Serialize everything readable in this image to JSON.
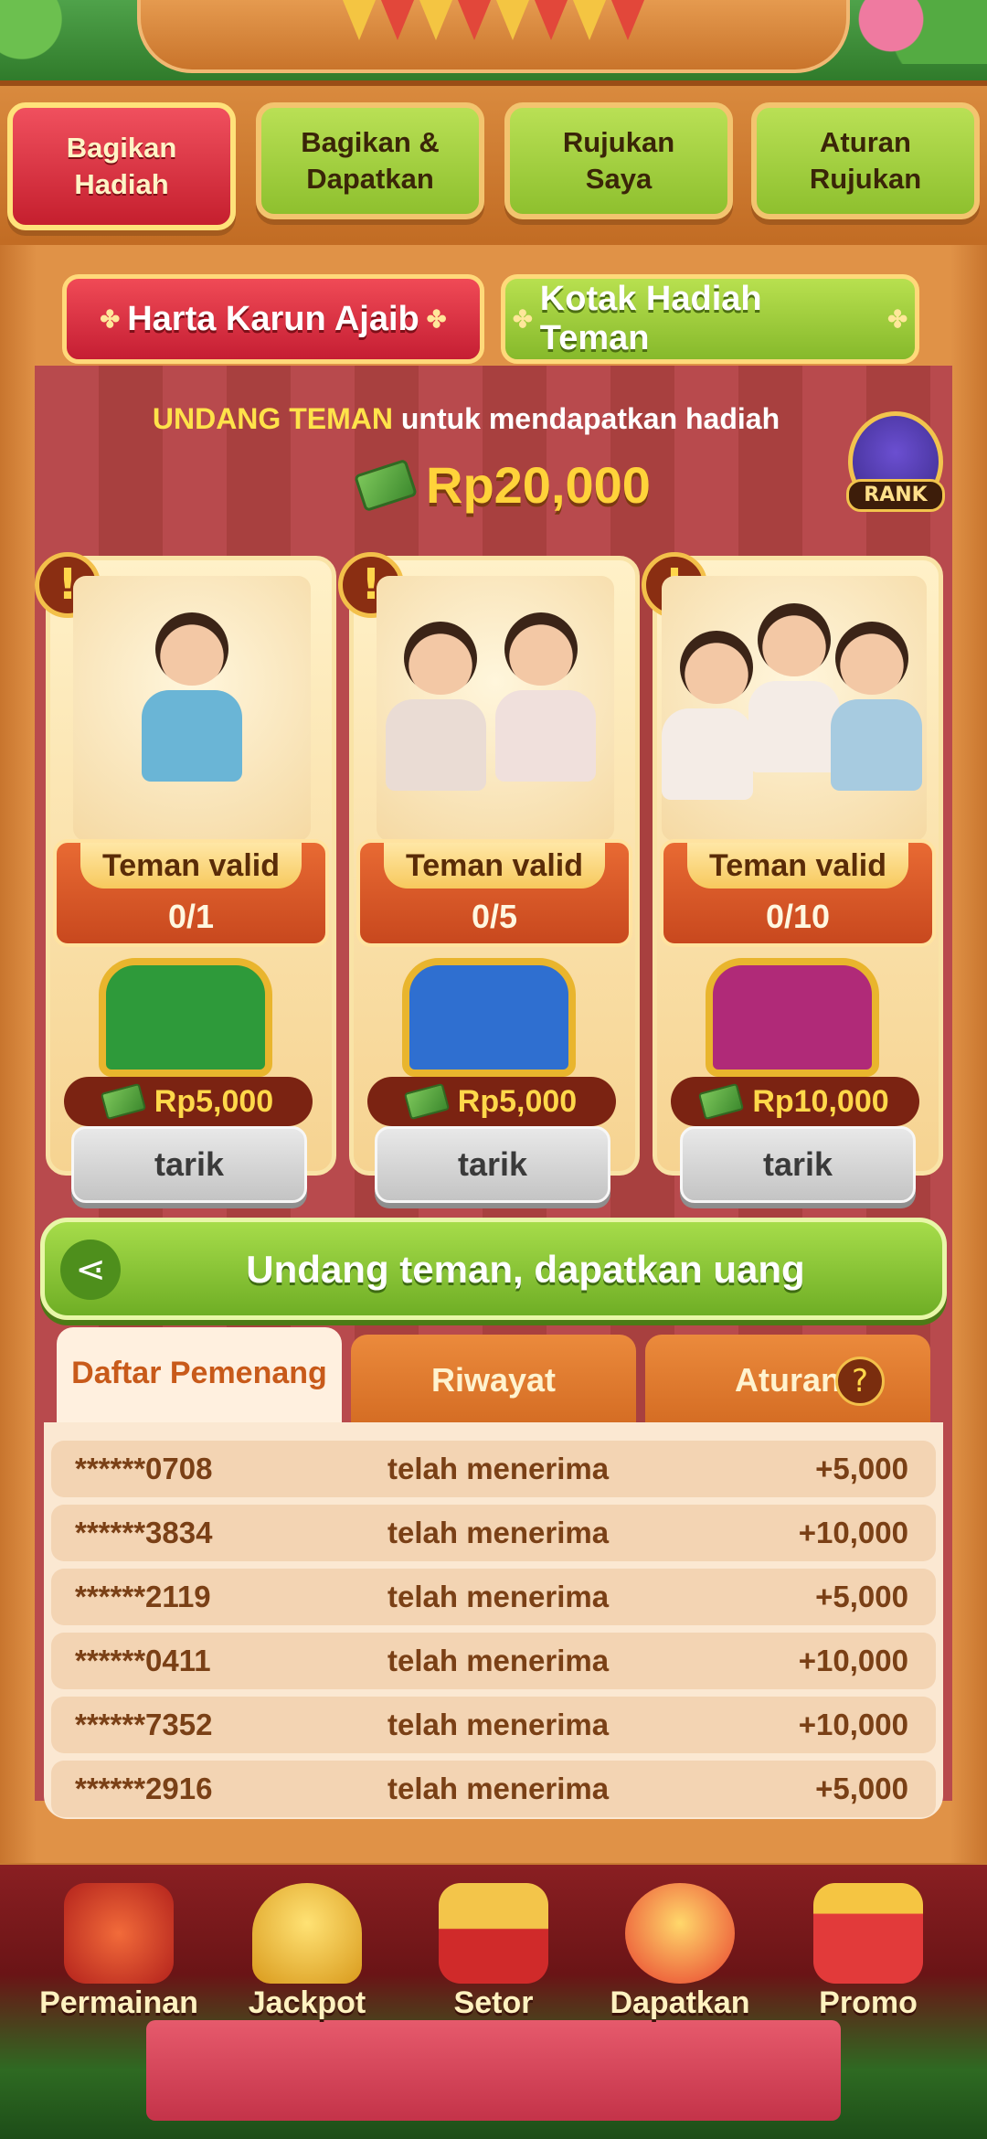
{
  "tabs": [
    {
      "label": "Bagikan\nHadiah",
      "active": true
    },
    {
      "label": "Bagikan &\nDapatkan",
      "active": false
    },
    {
      "label": "Rujukan\nSaya",
      "active": false
    },
    {
      "label": "Aturan\nRujukan",
      "active": false
    }
  ],
  "sub_buttons": {
    "treasure": "Harta Karun Ajaib",
    "friend_box": "Kotak Hadiah Teman"
  },
  "invite": {
    "highlight": "UNDANG TEMAN",
    "rest": " untuk mendapatkan hadiah",
    "amount": "Rp20,000",
    "rank_label": "RANK"
  },
  "cards": [
    {
      "valid_label": "Teman valid",
      "count": "0/1",
      "reward": "Rp5,000",
      "button": "tarik",
      "chest_color": "#2e9a3a"
    },
    {
      "valid_label": "Teman valid",
      "count": "0/5",
      "reward": "Rp5,000",
      "button": "tarik",
      "chest_color": "#2f6fd0"
    },
    {
      "valid_label": "Teman valid",
      "count": "0/10",
      "reward": "Rp10,000",
      "button": "tarik",
      "chest_color": "#b02a78"
    }
  ],
  "invite_button": "Undang teman, dapatkan uang",
  "list_tabs": {
    "winners": "Daftar Pemenang",
    "history": "Riwayat",
    "rules": "Aturan",
    "help": "?"
  },
  "winners": [
    {
      "user": "******0708",
      "status": "telah menerima",
      "amount": "+5,000"
    },
    {
      "user": "******3834",
      "status": "telah menerima",
      "amount": "+10,000"
    },
    {
      "user": "******2119",
      "status": "telah menerima",
      "amount": "+5,000"
    },
    {
      "user": "******0411",
      "status": "telah menerima",
      "amount": "+10,000"
    },
    {
      "user": "******7352",
      "status": "telah menerima",
      "amount": "+10,000"
    },
    {
      "user": "******2916",
      "status": "telah menerima",
      "amount": "+5,000"
    }
  ],
  "bottom_nav": [
    {
      "label": "Permainan",
      "icon": "slot-machine-icon"
    },
    {
      "label": "Jackpot",
      "icon": "trophy-icon"
    },
    {
      "label": "Setor",
      "icon": "coin-chest-icon"
    },
    {
      "label": "Dapatkan",
      "icon": "phone-gift-icon"
    },
    {
      "label": "Promo",
      "icon": "gift-box-icon"
    }
  ]
}
